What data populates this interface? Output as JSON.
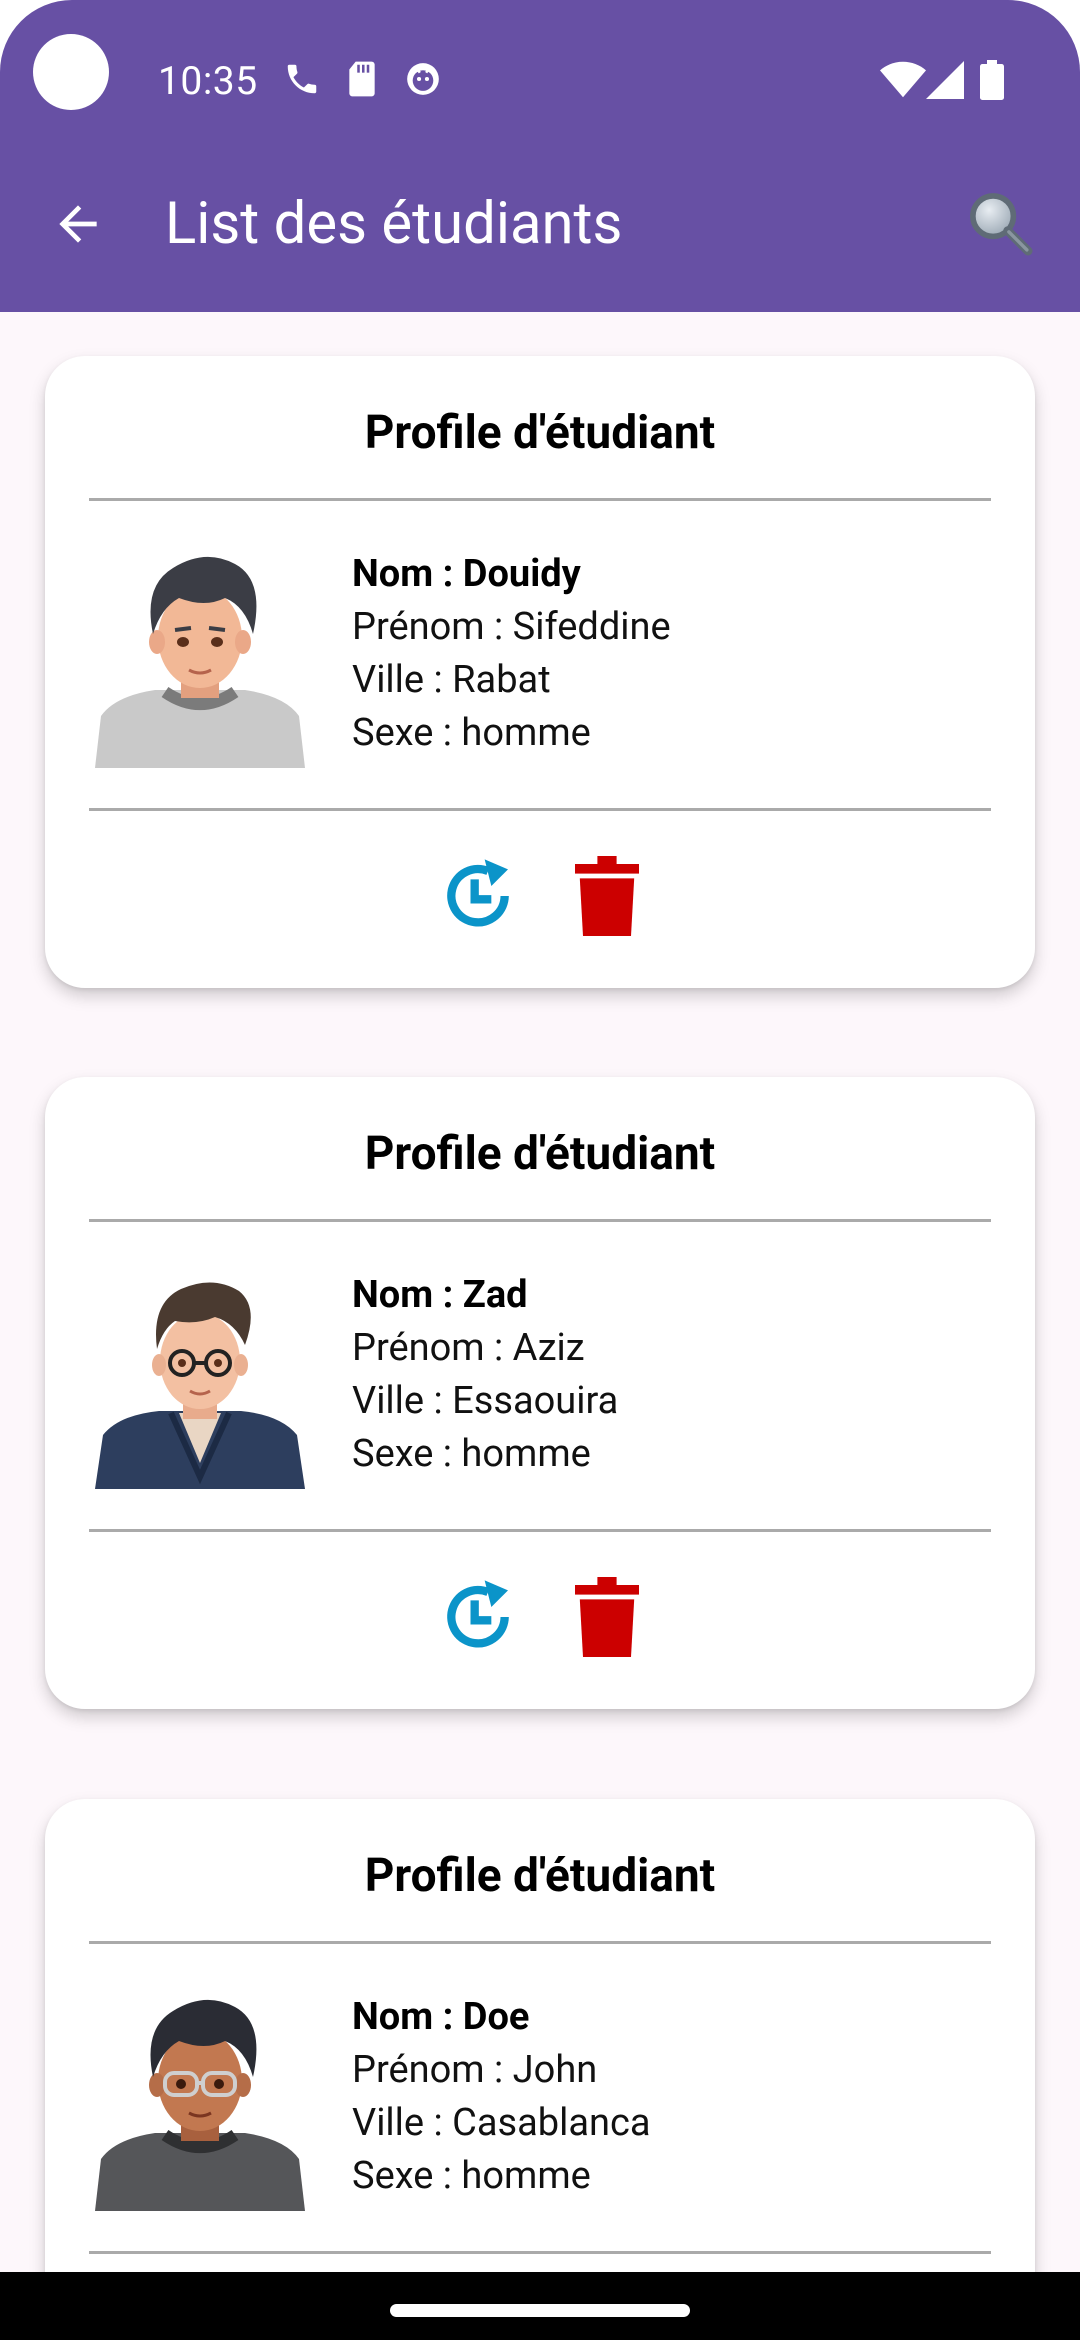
{
  "status_bar": {
    "time": "10:35",
    "left_icons": [
      "phone-icon",
      "sd-card-icon",
      "debug-icon"
    ],
    "right_icons": [
      "wifi-icon",
      "signal-icon",
      "battery-icon"
    ]
  },
  "toolbar": {
    "title": "List des étudiants",
    "back_icon": "arrow-back-icon",
    "search_icon": "search-icon",
    "color": "#6750a4"
  },
  "cards": [
    {
      "title": "Profile d'étudiant",
      "nom": "Nom : Douidy",
      "prenom": "Prénom : Sifeddine",
      "ville": "Ville : Rabat",
      "sexe": "Sexe : homme",
      "avatar": "male-avatar-gray-shirt"
    },
    {
      "title": "Profile d'étudiant",
      "nom": "Nom : Zad",
      "prenom": "Prénom : Aziz",
      "ville": "Ville : Essaouira",
      "sexe": "Sexe : homme",
      "avatar": "male-avatar-glasses-navy-jacket"
    },
    {
      "title": "Profile d'étudiant",
      "nom": "Nom : Doe",
      "prenom": "Prénom : John",
      "ville": "Ville : Casablanca",
      "sexe": "Sexe : homme",
      "avatar": "male-avatar-glasses-dark-shirt"
    }
  ],
  "colors": {
    "update_icon": "#0b94c9",
    "delete_icon": "#cc0000"
  }
}
